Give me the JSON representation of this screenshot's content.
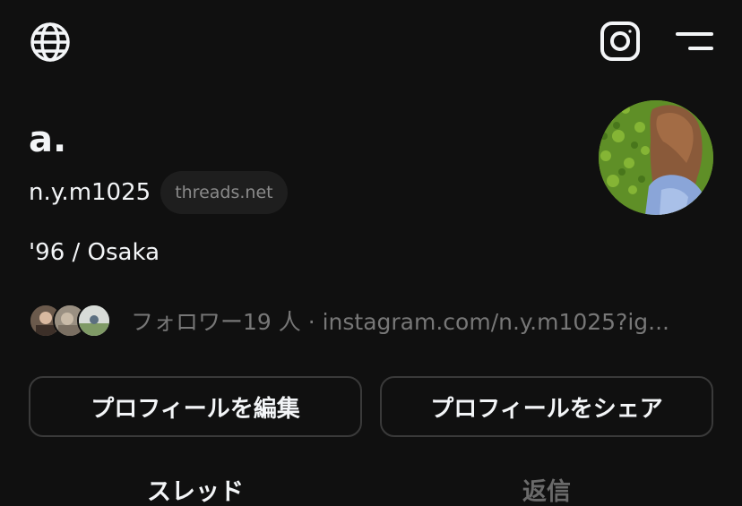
{
  "header": {
    "icons": {
      "left": "globe-icon",
      "right_1": "instagram-icon",
      "right_2": "menu-icon"
    }
  },
  "profile": {
    "display_name": "a.",
    "username": "n.y.m1025",
    "domain_badge": "threads.net",
    "bio": "'96 / Osaka",
    "followers_line": "フォロワー19 人 · instagram.com/n.y.m1025?ig..."
  },
  "actions": {
    "edit_label": "プロフィールを編集",
    "share_label": "プロフィールをシェア"
  },
  "tabs": [
    {
      "label": "スレッド",
      "active": true
    },
    {
      "label": "返信",
      "active": false
    }
  ],
  "colors": {
    "background": "#101010",
    "text_primary": "#f3f5f7",
    "text_secondary": "#777777",
    "button_border": "#3a3a3a",
    "badge_bg": "#1e1e1e"
  }
}
